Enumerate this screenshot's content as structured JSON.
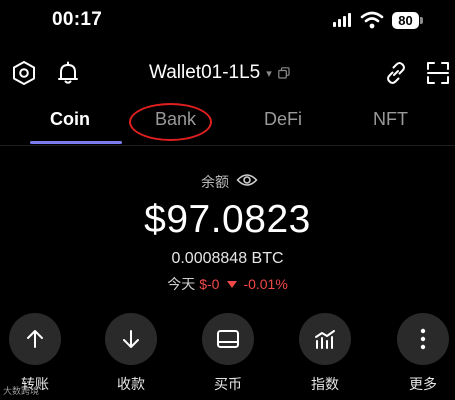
{
  "status_bar": {
    "time": "00:17",
    "battery": "80"
  },
  "header": {
    "wallet_name": "Wallet01-1L5"
  },
  "tabs": [
    {
      "label": "Coin",
      "active": true
    },
    {
      "label": "Bank"
    },
    {
      "label": "DeFi"
    },
    {
      "label": "NFT"
    }
  ],
  "balance": {
    "label": "余额",
    "amount": "$97.0823",
    "btc": "0.0008848 BTC",
    "today_label": "今天",
    "change_amount": "$-0",
    "change_percent": "-0.01%"
  },
  "actions": [
    {
      "label": "转账",
      "icon": "arrow-up-icon"
    },
    {
      "label": "收款",
      "icon": "arrow-down-icon"
    },
    {
      "label": "买币",
      "icon": "card-icon"
    },
    {
      "label": "指数",
      "icon": "chart-icon"
    },
    {
      "label": "更多",
      "icon": "more-vertical-icon"
    }
  ],
  "watermark": "大数跨境",
  "colors": {
    "accent": "#7b7cf0",
    "negative": "#f04848",
    "annotation": "#e02020"
  }
}
